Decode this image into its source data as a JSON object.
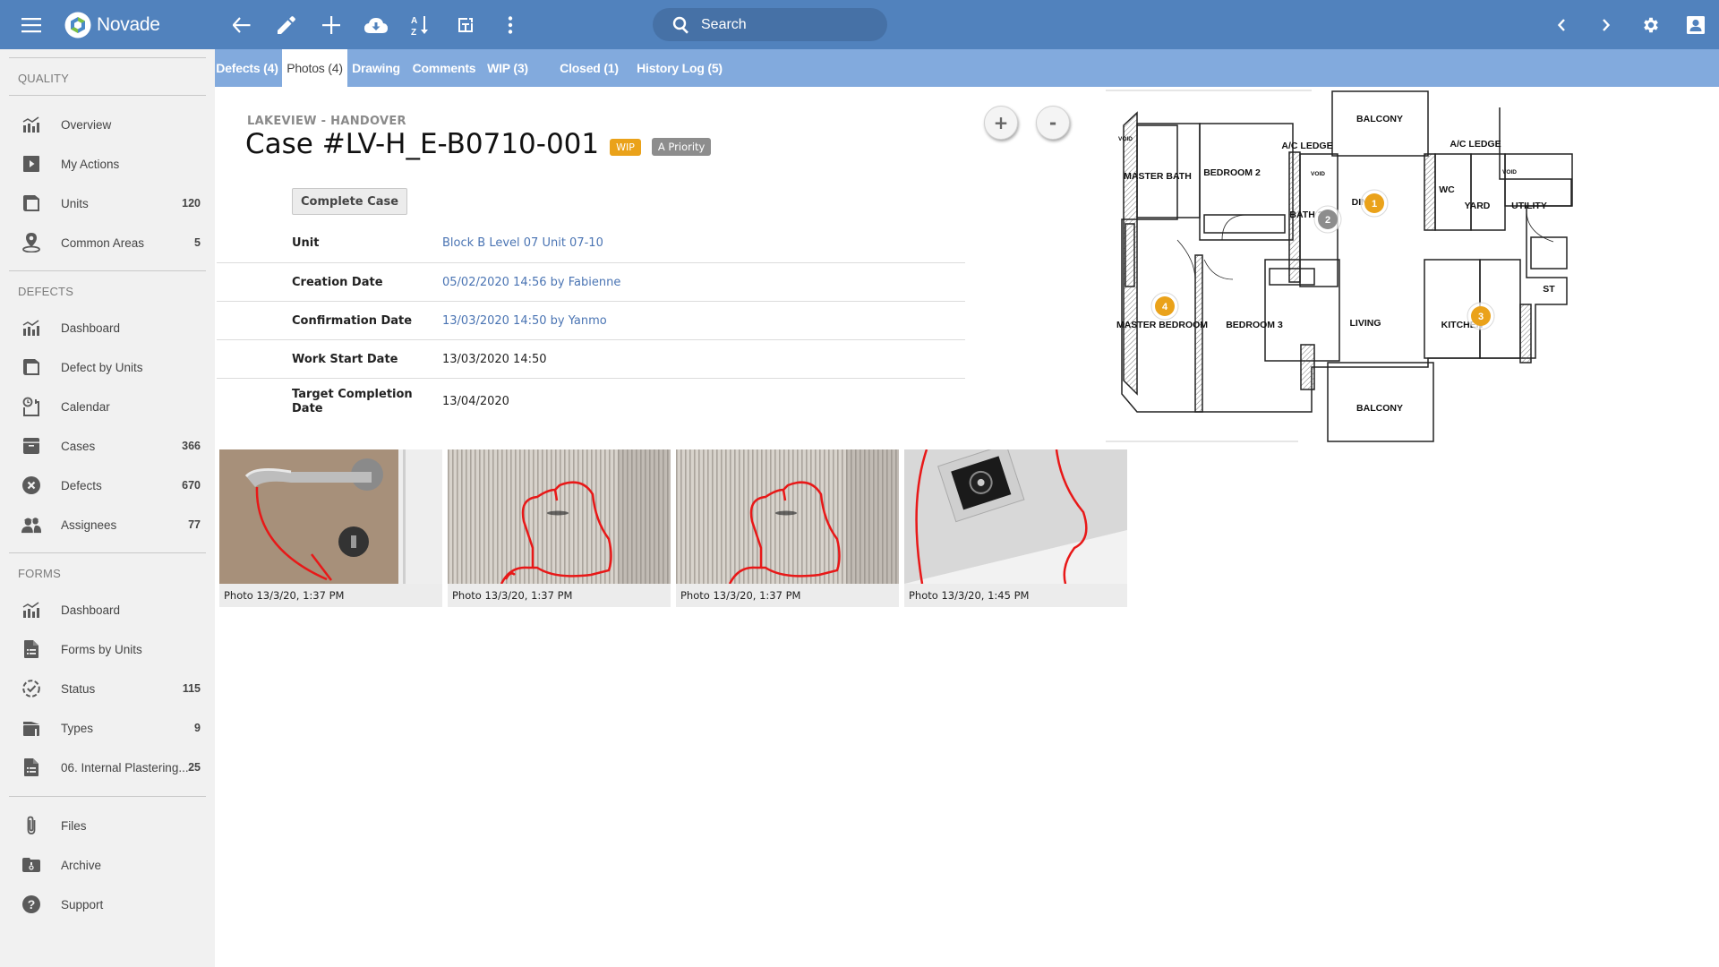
{
  "app": {
    "name": "Novade",
    "colors": {
      "header": "#5182bd",
      "tabbar": "#82aadd",
      "sidebar": "#f1f1f1",
      "wip": "#eaa21a",
      "priority": "#8d8d8d",
      "link": "#4a74b3"
    }
  },
  "header": {
    "menu_icon": "hamburger-icon",
    "toolbar": [
      {
        "name": "back",
        "icon": "arrow-left-icon"
      },
      {
        "name": "edit",
        "icon": "pencil-icon"
      },
      {
        "name": "add",
        "icon": "plus-icon"
      },
      {
        "name": "download",
        "icon": "cloud-download-icon"
      },
      {
        "name": "sort",
        "icon": "sort-az-icon"
      },
      {
        "name": "export",
        "icon": "export-icon"
      },
      {
        "name": "more",
        "icon": "more-vertical-icon"
      }
    ],
    "search": {
      "placeholder": "Search",
      "value": ""
    },
    "right": [
      {
        "name": "previous",
        "icon": "chevron-left-icon"
      },
      {
        "name": "next",
        "icon": "chevron-right-icon"
      },
      {
        "name": "settings",
        "icon": "gear-icon"
      },
      {
        "name": "account",
        "icon": "user-icon"
      }
    ]
  },
  "tabs": [
    {
      "label": "Defects (4)",
      "active": false
    },
    {
      "label": "Photos (4)",
      "active": true
    },
    {
      "label": "Drawing",
      "active": false
    },
    {
      "label": "Comments",
      "active": false
    },
    {
      "label": "WIP (3)",
      "active": false
    },
    {
      "label": "Closed (1)",
      "active": false
    },
    {
      "label": "History Log (5)",
      "active": false
    }
  ],
  "sidebar": {
    "sections": [
      {
        "title": "QUALITY",
        "items": [
          {
            "label": "Overview",
            "icon": "chart-icon",
            "count": ""
          },
          {
            "label": "My Actions",
            "icon": "play-icon",
            "count": ""
          },
          {
            "label": "Units",
            "icon": "units-icon",
            "count": "120"
          },
          {
            "label": "Common Areas",
            "icon": "location-pin-icon",
            "count": "5"
          }
        ]
      },
      {
        "title": "DEFECTS",
        "items": [
          {
            "label": "Dashboard",
            "icon": "chart-icon",
            "count": ""
          },
          {
            "label": "Defect by Units",
            "icon": "units-icon",
            "count": ""
          },
          {
            "label": "Calendar",
            "icon": "calendar-clock-icon",
            "count": ""
          },
          {
            "label": "Cases",
            "icon": "case-box-icon",
            "count": "366"
          },
          {
            "label": "Defects",
            "icon": "x-circle-icon",
            "count": "670"
          },
          {
            "label": "Assignees",
            "icon": "workers-icon",
            "count": "77"
          }
        ]
      },
      {
        "title": "FORMS",
        "items": [
          {
            "label": "Dashboard",
            "icon": "chart-icon",
            "count": ""
          },
          {
            "label": "Forms by Units",
            "icon": "form-document-icon",
            "count": ""
          },
          {
            "label": "Status",
            "icon": "dashed-check-circle-icon",
            "count": "115"
          },
          {
            "label": "Types",
            "icon": "folder-icon",
            "count": "9"
          },
          {
            "label": "06. Internal Plastering...",
            "icon": "form-document-icon",
            "count": "25"
          }
        ]
      },
      {
        "title": "",
        "items": [
          {
            "label": "Files",
            "icon": "paperclip-icon",
            "count": ""
          },
          {
            "label": "Archive",
            "icon": "archive-icon",
            "count": ""
          },
          {
            "label": "Support",
            "icon": "help-circle-icon",
            "count": ""
          }
        ]
      }
    ]
  },
  "case": {
    "project": "LAKEVIEW - HANDOVER",
    "title": "Case #LV-H_E-B0710-001",
    "status_badge": "WIP",
    "priority_badge": "A Priority",
    "complete_button": "Complete Case",
    "details": [
      {
        "label": "Unit",
        "value": "Block B Level 07 Unit 07-10",
        "link": true
      },
      {
        "label": "Creation Date",
        "value": "05/02/2020 14:56 by Fabienne",
        "link": true
      },
      {
        "label": "Confirmation Date",
        "value": "13/03/2020 14:50 by Yanmo",
        "link": true
      },
      {
        "label": "Work Start Date",
        "value": "13/03/2020 14:50",
        "link": false
      },
      {
        "label": "Target Completion Date",
        "value": "13/04/2020",
        "link": false
      }
    ]
  },
  "drawing": {
    "zoom_in": "+",
    "zoom_out": "-",
    "rooms": [
      "BALCONY",
      "A/C LEDGE",
      "A/C LEDGE",
      "MASTER BATH",
      "BEDROOM 2",
      "BATH 2",
      "DINING",
      "WC",
      "YARD",
      "UTILITY",
      "ST",
      "MASTER BEDROOM",
      "BEDROOM 3",
      "LIVING",
      "KITCHEN",
      "BALCONY",
      "VOID",
      "VOID",
      "VOID"
    ],
    "markers": [
      {
        "label": "1",
        "status": "wip"
      },
      {
        "label": "2",
        "status": "closed"
      },
      {
        "label": "3",
        "status": "wip"
      },
      {
        "label": "4",
        "status": "wip"
      }
    ]
  },
  "photos": [
    {
      "caption": "Photo 13/3/20, 1:37 PM",
      "subject": "door handle and lock"
    },
    {
      "caption": "Photo 13/3/20, 1:37 PM",
      "subject": "marked wall scratch"
    },
    {
      "caption": "Photo 13/3/20, 1:37 PM",
      "subject": "marked wall scratch"
    },
    {
      "caption": "Photo 13/3/20, 1:45 PM",
      "subject": "ceiling downlight"
    }
  ]
}
